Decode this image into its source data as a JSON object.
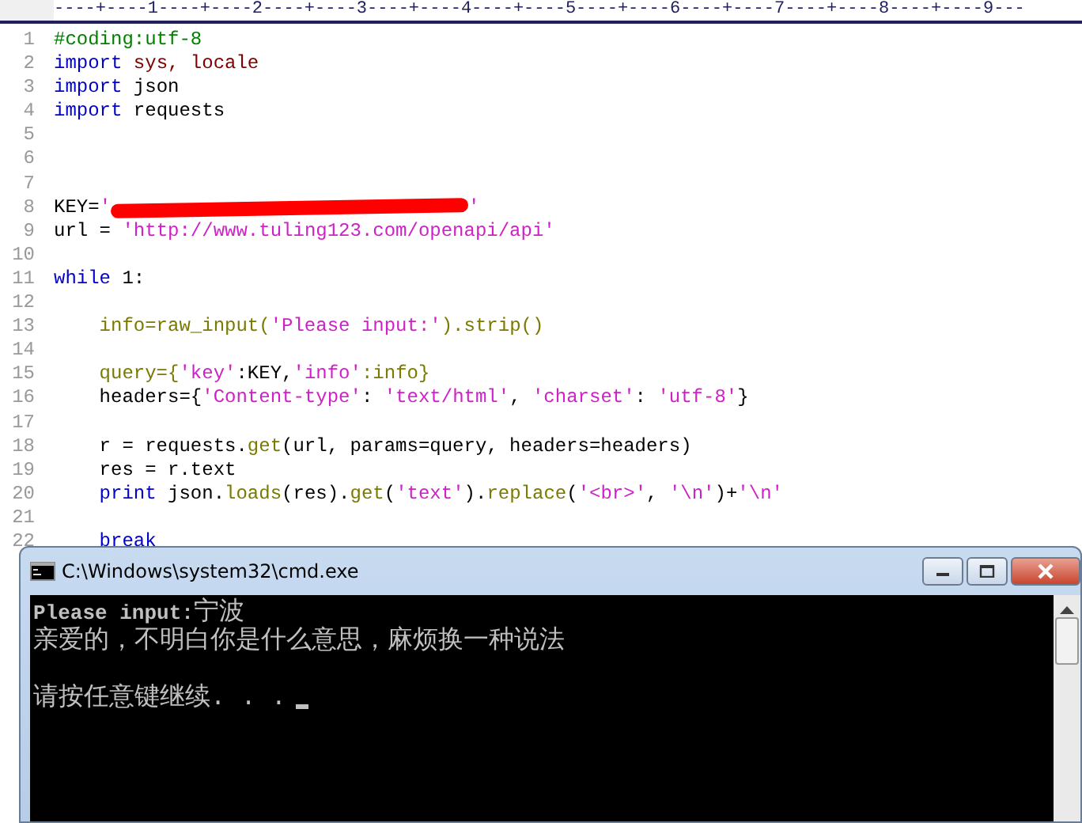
{
  "editor": {
    "ruler": "----+----1----+----2----+----3----+----4----+----5----+----6----+----7----+----8----+----9---",
    "lines": [
      {
        "number": "1",
        "tokens": [
          {
            "kind": "comment",
            "text": "#coding:utf-8"
          }
        ]
      },
      {
        "number": "2",
        "tokens": [
          {
            "kind": "keyword",
            "text": "import"
          },
          {
            "kind": "module",
            "text": " sys, locale"
          }
        ]
      },
      {
        "number": "3",
        "tokens": [
          {
            "kind": "keyword",
            "text": "import"
          },
          {
            "kind": "plain",
            "text": " json"
          }
        ]
      },
      {
        "number": "4",
        "tokens": [
          {
            "kind": "keyword",
            "text": "import"
          },
          {
            "kind": "plain",
            "text": " requests"
          }
        ]
      },
      {
        "number": "5"
      },
      {
        "number": "6"
      },
      {
        "number": "7"
      },
      {
        "number": "8",
        "tokens": [
          {
            "kind": "plain",
            "text": "KEY="
          },
          {
            "kind": "string",
            "text": "'"
          },
          {
            "kind": "redacted"
          },
          {
            "kind": "string",
            "text": "'"
          }
        ]
      },
      {
        "number": "9",
        "tokens": [
          {
            "kind": "plain",
            "text": "url = "
          },
          {
            "kind": "string",
            "text": "'http://www.tuling123.com/openapi/api'"
          }
        ]
      },
      {
        "number": "10"
      },
      {
        "number": "11",
        "tokens": [
          {
            "kind": "keyword",
            "text": "while"
          },
          {
            "kind": "plain",
            "text": " 1:"
          }
        ]
      },
      {
        "number": "12"
      },
      {
        "number": "13",
        "tokens": [
          {
            "kind": "function",
            "text": "    info=raw_input("
          },
          {
            "kind": "string",
            "text": "'Please input:'"
          },
          {
            "kind": "function",
            "text": ").strip()"
          }
        ]
      },
      {
        "number": "14"
      },
      {
        "number": "15",
        "tokens": [
          {
            "kind": "function",
            "text": "    query={"
          },
          {
            "kind": "string",
            "text": "'key'"
          },
          {
            "kind": "plain",
            "text": ":KEY,"
          },
          {
            "kind": "string",
            "text": "'info'"
          },
          {
            "kind": "function",
            "text": ":info}"
          }
        ]
      },
      {
        "number": "16",
        "tokens": [
          {
            "kind": "plain",
            "text": "    headers={"
          },
          {
            "kind": "string",
            "text": "'Content-type'"
          },
          {
            "kind": "plain",
            "text": ": "
          },
          {
            "kind": "string",
            "text": "'text/html'"
          },
          {
            "kind": "plain",
            "text": ", "
          },
          {
            "kind": "string",
            "text": "'charset'"
          },
          {
            "kind": "plain",
            "text": ": "
          },
          {
            "kind": "string",
            "text": "'utf-8'"
          },
          {
            "kind": "plain",
            "text": "}"
          }
        ]
      },
      {
        "number": "17"
      },
      {
        "number": "18",
        "tokens": [
          {
            "kind": "plain",
            "text": "    r = requests."
          },
          {
            "kind": "function",
            "text": "get"
          },
          {
            "kind": "plain",
            "text": "(url, params=query, headers=headers)"
          }
        ]
      },
      {
        "number": "19",
        "tokens": [
          {
            "kind": "plain",
            "text": "    res = r.text"
          }
        ]
      },
      {
        "number": "20",
        "tokens": [
          {
            "kind": "keyword",
            "text": "    print"
          },
          {
            "kind": "plain",
            "text": " json."
          },
          {
            "kind": "function",
            "text": "loads"
          },
          {
            "kind": "plain",
            "text": "(res)."
          },
          {
            "kind": "function",
            "text": "get"
          },
          {
            "kind": "plain",
            "text": "("
          },
          {
            "kind": "string",
            "text": "'text'"
          },
          {
            "kind": "plain",
            "text": ")."
          },
          {
            "kind": "function",
            "text": "replace"
          },
          {
            "kind": "plain",
            "text": "("
          },
          {
            "kind": "string",
            "text": "'<br>'"
          },
          {
            "kind": "plain",
            "text": ", "
          },
          {
            "kind": "string",
            "text": "'\\n'"
          },
          {
            "kind": "plain",
            "text": ")+"
          },
          {
            "kind": "string",
            "text": "'\\n'"
          }
        ]
      },
      {
        "number": "21"
      },
      {
        "number": "22",
        "tokens": [
          {
            "kind": "keyword",
            "text": "    break"
          }
        ]
      }
    ]
  },
  "console": {
    "title": "C:\\Windows\\system32\\cmd.exe",
    "lines": [
      {
        "text": "**Please input:**宁波",
        "cursor": false
      },
      {
        "text": "亲爱的，不明白你是什么意思，麻烦换一种说法",
        "cursor": false
      },
      {
        "cursor": false
      },
      {
        "text": "请按任意键继续. . .",
        "cursor": true
      }
    ]
  }
}
